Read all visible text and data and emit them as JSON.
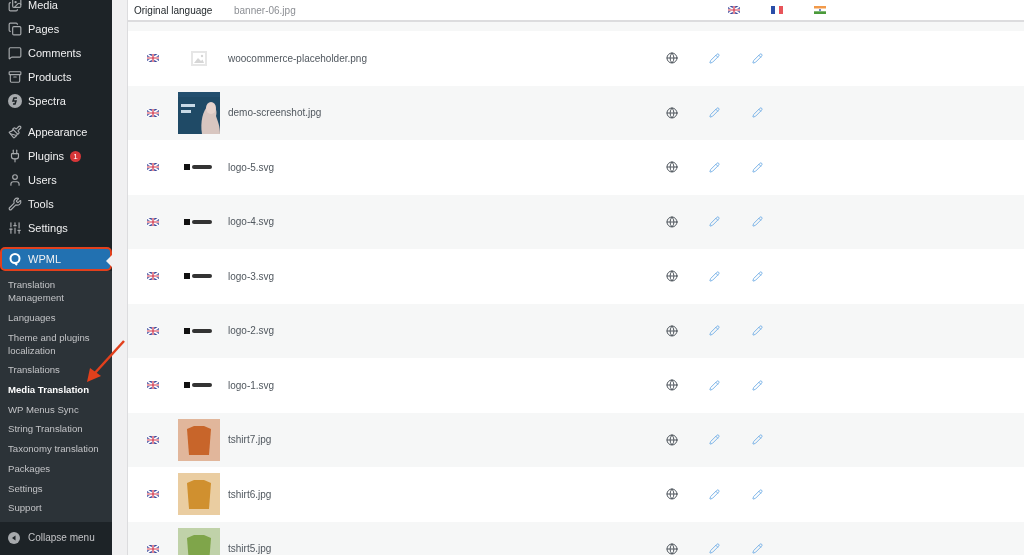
{
  "sidebar": {
    "menu": [
      {
        "label": "Media",
        "selected": false
      },
      {
        "label": "Pages",
        "selected": false
      },
      {
        "label": "Comments",
        "selected": false
      },
      {
        "label": "Products",
        "selected": false
      },
      {
        "label": "Spectra",
        "selected": false,
        "separator_after": true
      },
      {
        "label": "Appearance",
        "selected": false
      },
      {
        "label": "Plugins",
        "selected": false,
        "badge": "1"
      },
      {
        "label": "Users",
        "selected": false
      },
      {
        "label": "Tools",
        "selected": false
      },
      {
        "label": "Settings",
        "selected": false,
        "separator_after": true
      },
      {
        "label": "WPML",
        "selected": true,
        "outlined": true
      }
    ],
    "submenu": [
      {
        "label": "Translation Management",
        "selected": false
      },
      {
        "label": "Languages",
        "selected": false
      },
      {
        "label": "Theme and plugins localization",
        "selected": false
      },
      {
        "label": "Translations",
        "selected": false
      },
      {
        "label": "Media Translation",
        "selected": true
      },
      {
        "label": "WP Menus Sync",
        "selected": false
      },
      {
        "label": "String Translation",
        "selected": false
      },
      {
        "label": "Taxonomy translation",
        "selected": false
      },
      {
        "label": "Packages",
        "selected": false
      },
      {
        "label": "Settings",
        "selected": false
      },
      {
        "label": "Support",
        "selected": false
      }
    ],
    "collapse": "Collapse menu"
  },
  "table": {
    "header": {
      "label": "Original language",
      "behind": "banner-06.jpg",
      "languages": [
        {
          "kind": "uk"
        },
        {
          "kind": "fr"
        },
        {
          "kind": "in"
        }
      ]
    },
    "rows": [
      {
        "flag": {
          "kind": "uk"
        },
        "thumb": {
          "kind": "placeholder"
        },
        "name": "woocommerce-placeholder.png",
        "cells": [
          {
            "kind": "original"
          },
          {
            "kind": "edit"
          },
          {
            "kind": "edit"
          }
        ]
      },
      {
        "flag": {
          "kind": "uk"
        },
        "name": "demo-screenshot.jpg",
        "cells": [
          {
            "kind": "original"
          },
          {
            "kind": "edit"
          },
          {
            "kind": "edit"
          }
        ]
      },
      {
        "flag": {
          "kind": "uk"
        },
        "thumb": {
          "kind": "logo"
        },
        "name": "logo-5.svg",
        "cells": [
          {
            "kind": "original"
          },
          {
            "kind": "edit"
          },
          {
            "kind": "edit"
          }
        ]
      },
      {
        "flag": {
          "kind": "uk"
        },
        "thumb": {
          "kind": "logo"
        },
        "name": "logo-4.svg",
        "cells": [
          {
            "kind": "original"
          },
          {
            "kind": "edit"
          },
          {
            "kind": "edit"
          }
        ]
      },
      {
        "flag": {
          "kind": "uk"
        },
        "thumb": {
          "kind": "logo"
        },
        "name": "logo-3.svg",
        "cells": [
          {
            "kind": "original"
          },
          {
            "kind": "edit"
          },
          {
            "kind": "edit"
          }
        ]
      },
      {
        "flag": {
          "kind": "uk"
        },
        "thumb": {
          "kind": "logo"
        },
        "name": "logo-2.svg",
        "cells": [
          {
            "kind": "original"
          },
          {
            "kind": "edit"
          },
          {
            "kind": "edit"
          }
        ]
      },
      {
        "flag": {
          "kind": "uk"
        },
        "thumb": {
          "kind": "logo"
        },
        "name": "logo-1.svg",
        "cells": [
          {
            "kind": "original"
          },
          {
            "kind": "edit"
          },
          {
            "kind": "edit"
          }
        ]
      },
      {
        "flag": {
          "kind": "uk"
        },
        "thumb": {
          "kind": "tshirt",
          "color": "#c8652a"
        },
        "name": "tshirt7.jpg",
        "cells": [
          {
            "kind": "original"
          },
          {
            "kind": "edit"
          },
          {
            "kind": "edit"
          }
        ]
      },
      {
        "flag": {
          "kind": "uk"
        },
        "thumb": {
          "kind": "tshirt",
          "color": "#d0902f"
        },
        "name": "tshirt6.jpg",
        "cells": [
          {
            "kind": "original"
          },
          {
            "kind": "edit"
          },
          {
            "kind": "edit"
          }
        ]
      },
      {
        "flag": {
          "kind": "uk"
        },
        "thumb": {
          "kind": "tshirt",
          "color": "#7fa54a"
        },
        "name": "tshirt5.jpg",
        "cells": [
          {
            "kind": "original"
          },
          {
            "kind": "edit"
          },
          {
            "kind": "edit"
          }
        ]
      }
    ]
  }
}
